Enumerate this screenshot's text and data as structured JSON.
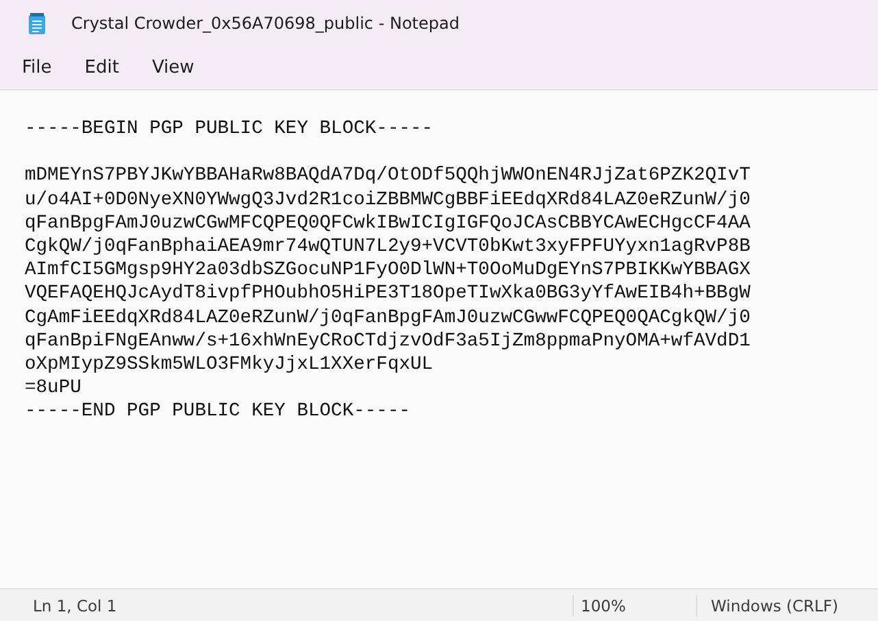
{
  "window": {
    "title": "Crystal Crowder_0x56A70698_public - Notepad"
  },
  "menu": [
    "File",
    "Edit",
    "View"
  ],
  "document": {
    "begin_marker": "-----BEGIN PGP PUBLIC KEY BLOCK-----",
    "key_lines": [
      "mDMEYnS7PBYJKwYBBAHaRw8BAQdA7Dq/OtODf5QQhjWWOnEN4RJjZat6PZK2QIvT",
      "u/o4AI+0D0NyeXN0YWwgQ3Jvd2R1coiZBBMWCgBBFiEEdqXRd84LAZ0eRZunW/j0",
      "qFanBpgFAmJ0uzwCGwMFCQPEQ0QFCwkIBwICIgIGFQoJCAsCBBYCAwECHgcCF4AA",
      "CgkQW/j0qFanBphaiAEA9mr74wQTUN7L2y9+VCVT0bKwt3xyFPFUYyxn1agRvP8B",
      "AImfCI5GMgsp9HY2a03dbSZGocuNP1FyO0DlWN+T0OoMuDgEYnS7PBIKKwYBBAGX",
      "VQEFAQEHQJcAydT8ivpfPHOubhO5HiPE3T18OpeTIwXka0BG3yYfAwEIB4h+BBgW",
      "CgAmFiEEdqXRd84LAZ0eRZunW/j0qFanBpgFAmJ0uzwCGwwFCQPEQ0QACgkQW/j0",
      "qFanBpiFNgEAnww/s+16xhWnEyCRoCTdjzvOdF3a5IjZm8ppmaPnyOMA+wfAVdD1",
      "oXpMIypZ9SSkm5WLO3FMkyJjxL1XXerFqxUL"
    ],
    "checksum": "=8uPU",
    "end_marker": "-----END PGP PUBLIC KEY BLOCK-----"
  },
  "status_bar": {
    "position": "Ln 1, Col 1",
    "zoom": "100%",
    "line_ending": "Windows (CRLF)"
  }
}
